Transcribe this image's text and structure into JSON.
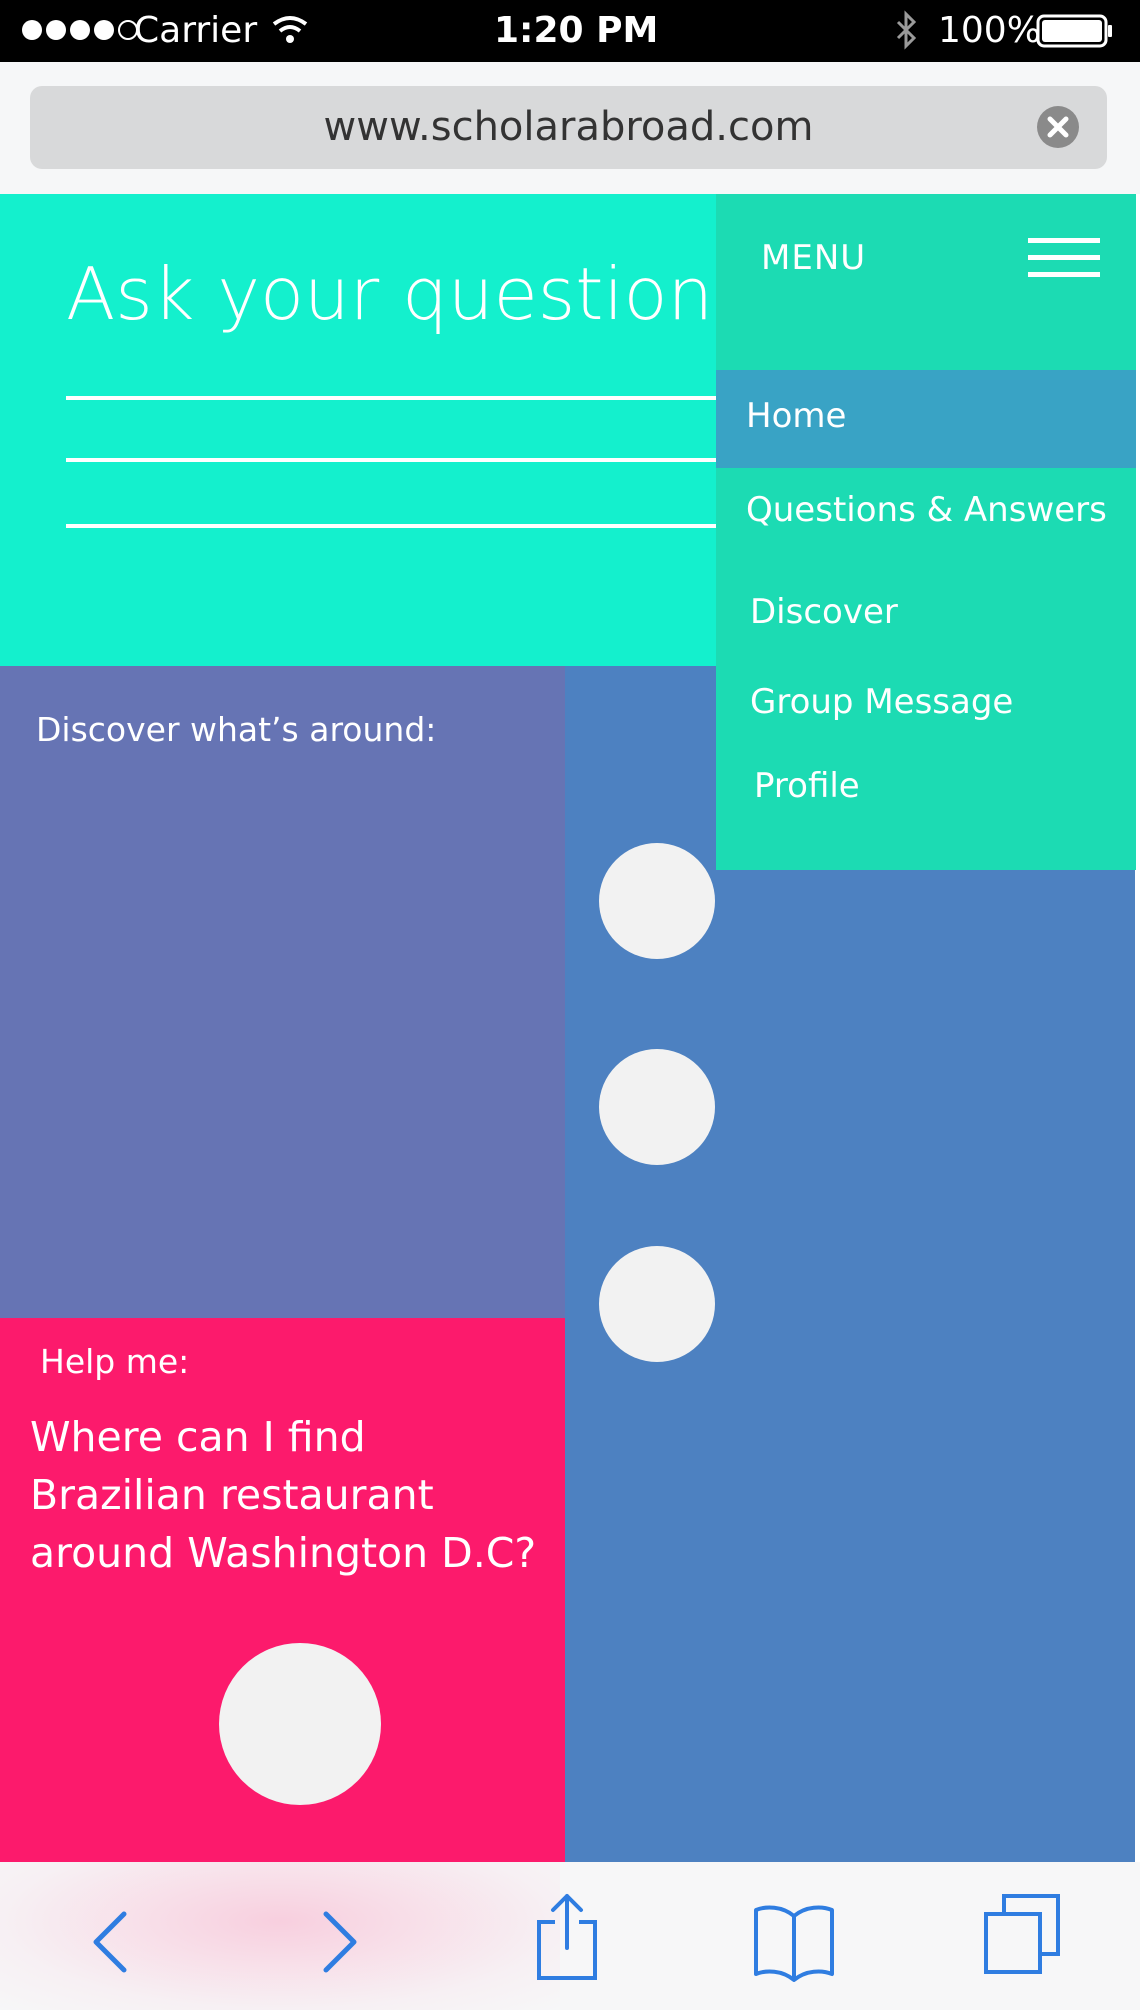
{
  "status_bar": {
    "carrier": "Carrier",
    "time": "1:20 PM",
    "battery": "100%",
    "signal_dots_filled": 4,
    "signal_dots_total": 5
  },
  "browser": {
    "url": "www.scholarabroad.com"
  },
  "hero": {
    "title": "Ask your question"
  },
  "discover": {
    "label": "Discover what’s around:"
  },
  "help": {
    "label": "Help me:",
    "question": "Where can I find Brazilian restaurant around Washington D.C?"
  },
  "menu": {
    "label": "MENU",
    "items": [
      {
        "label": "Home",
        "active": true
      },
      {
        "label": "Questions & Answers",
        "active": false
      },
      {
        "label": "Discover",
        "active": false
      },
      {
        "label": "Group Message",
        "active": false
      },
      {
        "label": "Profile",
        "active": false
      }
    ]
  },
  "toolbar": {
    "icons": [
      "back-icon",
      "forward-icon",
      "share-icon",
      "bookmarks-icon",
      "tabs-icon"
    ]
  },
  "colors": {
    "hero": "#14f0cd",
    "menu": "#1cdbb3",
    "menu_active": "#39a3c5",
    "discover": "#6674b4",
    "right_column": "#4d81c1",
    "help": "#fc1a6c",
    "toolbar_icon": "#2f7de1"
  }
}
